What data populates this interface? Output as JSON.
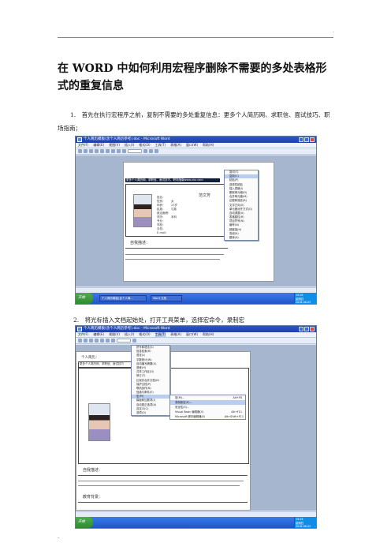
{
  "header": {
    "mark": "."
  },
  "article": {
    "title": "在 WORD 中如何利用宏程序删除不需要的多处表格形式的重复信息",
    "step1": "1.　首先在执行宏程序之前，复制不需要的多处重复信息：更多个人简历网、求职信、面试技巧、职场指南；",
    "step2": "2.　将光标插入文档起始处，打开工具菜单，选择宏命令，录制宏"
  },
  "screenshot1": {
    "window_title": "个人简历模板(含个人简历参考).doc - Microsoft Word",
    "menu": [
      "文件(F)",
      "编辑(E)",
      "视图(V)",
      "插入(I)",
      "格式(O)",
      "工具(T)",
      "表格(A)",
      "窗口(W)",
      "帮助(H)"
    ],
    "selected_text": "更多个人简历网、求职信、面试技巧、职场指南www.xxx.com",
    "resume_name": "范文芳",
    "section_label": "自我描述：",
    "field_labels": [
      "姓名：",
      "性别：",
      "年龄：",
      "民族：",
      "政治面貌：",
      "学历：",
      "专业：",
      "学校：",
      "手机：",
      "E-mail："
    ],
    "field_values": [
      "",
      "女",
      "23岁",
      "汉族",
      "",
      "本科",
      "",
      "",
      "",
      ""
    ],
    "context_menu": [
      "剪切(T)",
      "复制(C)",
      "粘贴(P)",
      "选择性粘贴",
      "插入表格(I)",
      "删除单元格(D)",
      "合并单元格(M)",
      "边框和底纹(B)",
      "文字方向(X)",
      "单元格对齐方式(G)",
      "自动调整(A)",
      "表格属性(R)",
      "项目符号(N)",
      "编号(N)",
      "超链接(H)",
      "查阅(K)",
      "翻译(A)"
    ],
    "taskbar_start": "开始",
    "taskbar_items": [
      "个人简历模板(含个人简...",
      "Word 文档"
    ],
    "tray": [
      "19:28",
      "星期四",
      "2016-06-03"
    ]
  },
  "screenshot2": {
    "window_title": "个人简历模板(含个人简历参考).doc - Microsoft Word",
    "menu": [
      "文件(F)",
      "编辑(E)",
      "视图(V)",
      "插入(I)",
      "格式(O)",
      "工具(T)",
      "表格(A)",
      "窗口(W)",
      "帮助(H)"
    ],
    "doc_heading": "个人简历：",
    "selected_text": "更多个人简历网、求职信、面试技巧",
    "tools_menu": [
      "拼写和语法(S)",
      "信息检索(R)",
      "语言(L)",
      "字数统计(W)",
      "自动编写摘要(U)",
      "语音(H)",
      "共享工作区(D)",
      "修订(T)",
      "比较并合并文档(D)",
      "保护文档(P)",
      "联机协作(N)",
      "信函与邮件(E)",
      "宏(M)",
      "模板和加载项(I)",
      "自动更正选项(A)",
      "自定义(C)",
      "选项(O)"
    ],
    "macro_submenu": [
      "宏(M)...",
      "录制新宏(R)...",
      "安全性(S)...",
      "Visual Basic 编辑器(V)",
      "Microsoft 脚本编辑器(E)"
    ],
    "macro_shortcuts": [
      "Alt+F8",
      "",
      "",
      "Alt+F11",
      "Alt+Shift+F11"
    ],
    "section_label": "自我描述：",
    "section_label2": "教育背景：",
    "taskbar_start": "开始",
    "tray": [
      "19:28",
      "星期四",
      "2016-06-03"
    ]
  },
  "footer": {
    "mark": "."
  }
}
